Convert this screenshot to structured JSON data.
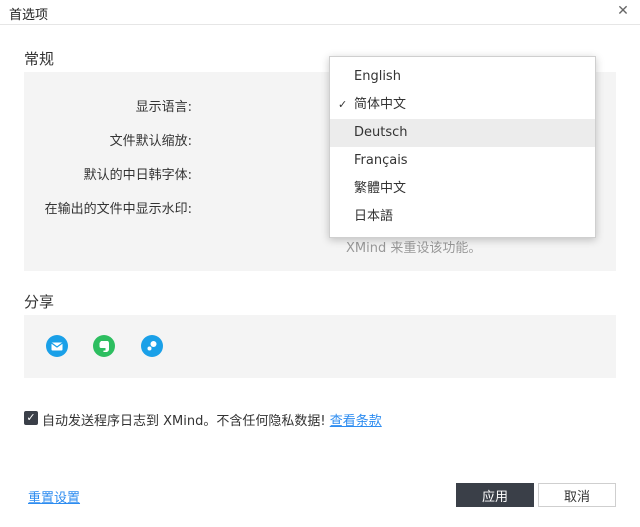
{
  "window": {
    "title": "首选项",
    "close_glyph": "✕"
  },
  "general": {
    "section_title": "常规",
    "rows": [
      {
        "label": "显示语言:"
      },
      {
        "label": "文件默认缩放:"
      },
      {
        "label": "默认的中日韩字体:"
      },
      {
        "label": "在输出的文件中显示水印:"
      }
    ],
    "hint": "XMind 来重设该功能。"
  },
  "language_dropdown": {
    "selected": "简体中文",
    "hovered": "Deutsch",
    "options": [
      {
        "label": "English",
        "checked": false
      },
      {
        "label": "简体中文",
        "checked": true
      },
      {
        "label": "Deutsch",
        "checked": false
      },
      {
        "label": "Français",
        "checked": false
      },
      {
        "label": "繁體中文",
        "checked": false
      },
      {
        "label": "日本語",
        "checked": false
      }
    ]
  },
  "share": {
    "section_title": "分享",
    "icons": [
      {
        "name": "mail-icon",
        "color": "#1aa0e8"
      },
      {
        "name": "evernote-icon",
        "color": "#2dbe60"
      },
      {
        "name": "biji-icon",
        "color": "#1aa0e8"
      }
    ]
  },
  "consent": {
    "checked": true,
    "text": "自动发送程序日志到 XMind。不含任何隐私数据!",
    "link": "查看条款"
  },
  "footer": {
    "reset_label": "重置设置",
    "apply_label": "应用",
    "cancel_label": "取消"
  },
  "colors": {
    "accent": "#2d8cf0",
    "primary_button": "#3a3f48",
    "panel_bg": "#f4f4f4"
  }
}
